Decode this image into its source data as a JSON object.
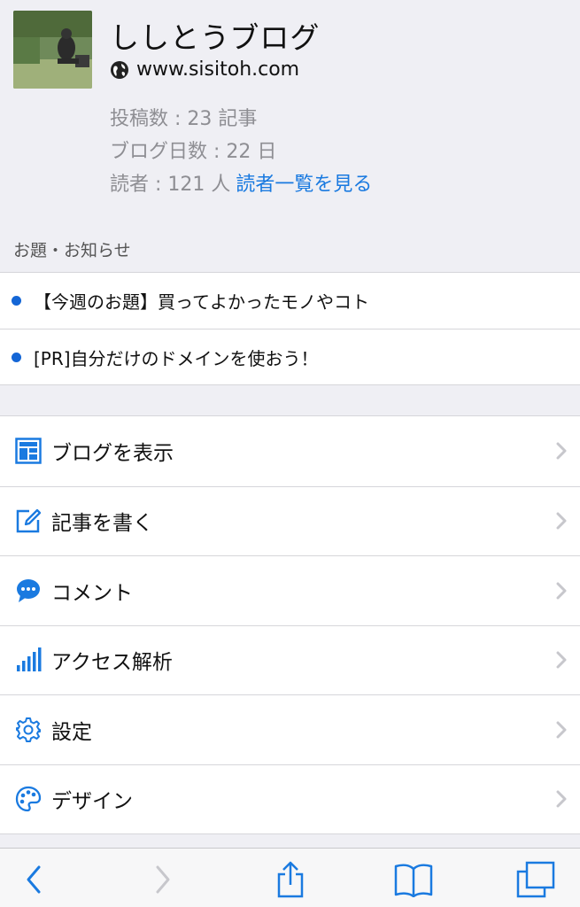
{
  "profile": {
    "blog_title": "ししとうブログ",
    "url": "www.sisitoh.com",
    "stats": {
      "posts": "投稿数 : 23 記事",
      "days": "ブログ日数 : 22 日",
      "readers": "読者 : 121 人",
      "readers_link": "読者一覧を見る"
    }
  },
  "notices": {
    "section_label": "お題・お知らせ",
    "items": [
      {
        "text": "【今週のお題】買ってよかったモノやコト"
      },
      {
        "text": "[PR]自分だけのドメインを使おう！"
      }
    ]
  },
  "menu": {
    "items": [
      {
        "label": "ブログを表示",
        "icon": "layout-icon"
      },
      {
        "label": "記事を書く",
        "icon": "pencil-icon"
      },
      {
        "label": "コメント",
        "icon": "comment-icon"
      },
      {
        "label": "アクセス解析",
        "icon": "bar-chart-icon"
      },
      {
        "label": "設定",
        "icon": "gear-icon"
      },
      {
        "label": "デザイン",
        "icon": "palette-icon"
      }
    ]
  },
  "colors": {
    "accent": "#1a7ae0",
    "background": "#efeff4",
    "muted_text": "#8e8e93"
  }
}
